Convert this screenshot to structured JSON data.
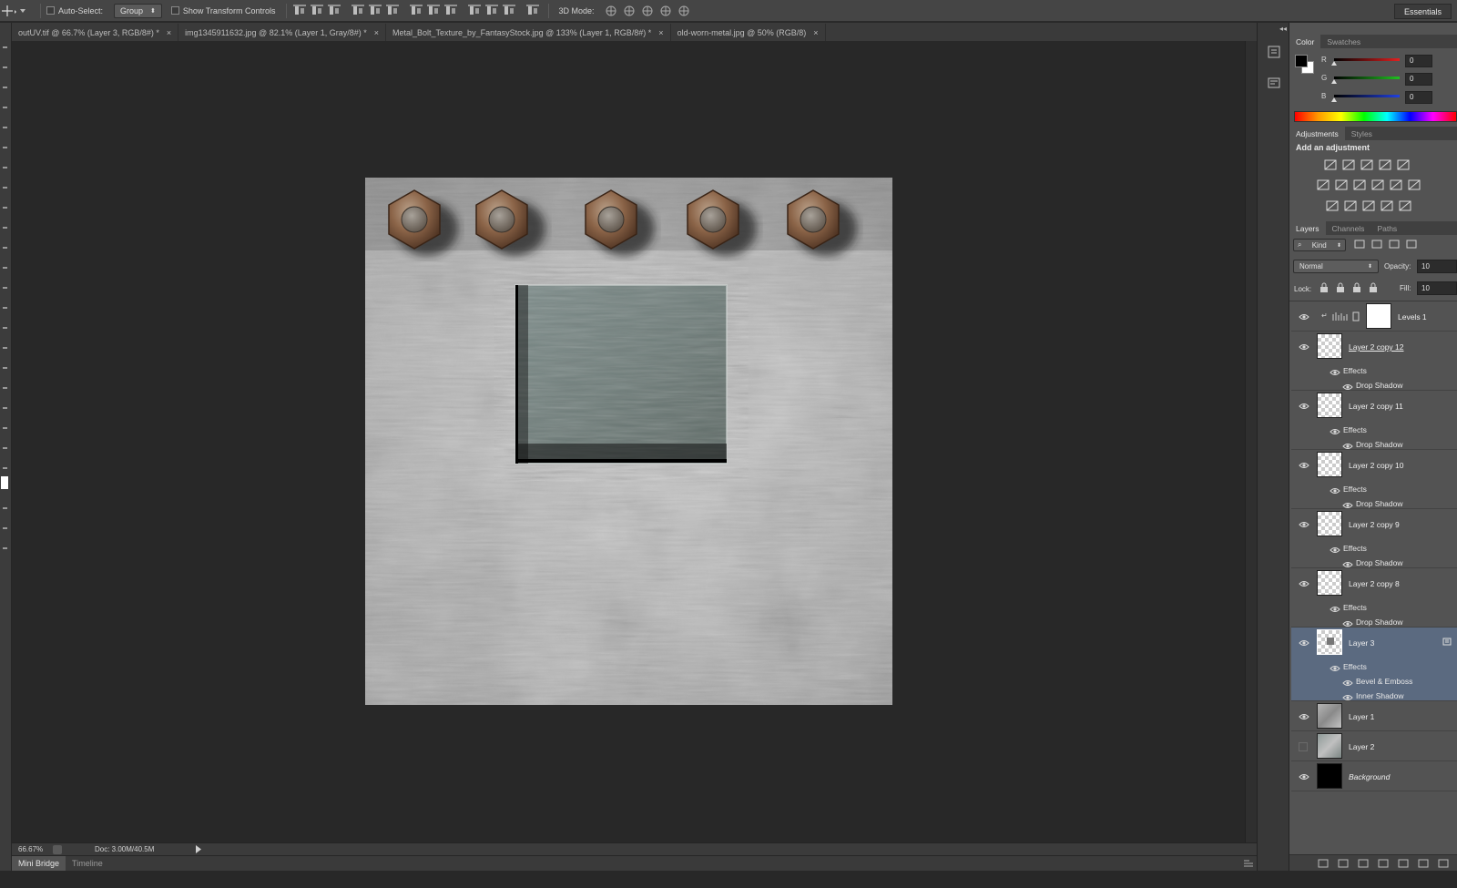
{
  "options_bar": {
    "auto_select_label": "Auto-Select:",
    "group_value": "Group",
    "show_transform_label": "Show Transform Controls",
    "mode_3d_label": "3D Mode:",
    "workspace": "Essentials"
  },
  "doc_tabs": [
    {
      "label": "outUV.tif @ 66.7% (Layer 3, RGB/8#) *",
      "active": true
    },
    {
      "label": "img1345911632.jpg @ 82.1% (Layer 1, Gray/8#) *",
      "active": false
    },
    {
      "label": "Metal_Bolt_Texture_by_FantasyStock.jpg @ 133% (Layer 1, RGB/8#) *",
      "active": false
    },
    {
      "label": "old-worn-metal.jpg @ 50% (RGB/8)",
      "active": false
    }
  ],
  "close_glyph": "×",
  "status": {
    "zoom": "66.67%",
    "doc": "Doc: 3.00M/40.5M"
  },
  "bottom_tabs": [
    "Mini Bridge",
    "Timeline"
  ],
  "color_panel": {
    "tabs": [
      "Color",
      "Swatches"
    ],
    "channels": [
      {
        "label": "R",
        "value": "0",
        "color": "#e02020"
      },
      {
        "label": "G",
        "value": "0",
        "color": "#20c020"
      },
      {
        "label": "B",
        "value": "0",
        "color": "#2040e0"
      }
    ],
    "foreground": "#000000",
    "background": "#ffffff"
  },
  "adjustments_panel": {
    "tabs": [
      "Adjustments",
      "Styles"
    ],
    "heading": "Add an adjustment"
  },
  "layers_panel": {
    "tabs": [
      "Layers",
      "Channels",
      "Paths"
    ],
    "filter_kind": "Kind",
    "blend_mode": "Normal",
    "opacity_label": "Opacity:",
    "opacity_value": "10",
    "lock_label": "Lock:",
    "fill_label": "Fill:",
    "fill_value": "10",
    "effects_label": "Effects",
    "layers": [
      {
        "name": "Levels 1",
        "type": "adjustment",
        "visible": true
      },
      {
        "name": "Layer 2 copy 12",
        "type": "empty",
        "visible": true,
        "effects": [
          "Drop Shadow"
        ]
      },
      {
        "name": "Layer 2 copy 11",
        "type": "empty",
        "visible": true,
        "effects": [
          "Drop Shadow"
        ]
      },
      {
        "name": "Layer 2 copy 10",
        "type": "empty",
        "visible": true,
        "effects": [
          "Drop Shadow"
        ]
      },
      {
        "name": "Layer 2 copy 9",
        "type": "empty",
        "visible": true,
        "effects": [
          "Drop Shadow"
        ]
      },
      {
        "name": "Layer 2 copy 8",
        "type": "empty",
        "visible": true,
        "effects": [
          "Drop Shadow"
        ]
      },
      {
        "name": "Layer 3",
        "type": "selected",
        "visible": true,
        "effects": [
          "Bevel & Emboss",
          "Inner Shadow"
        ]
      },
      {
        "name": "Layer 1",
        "type": "texture",
        "visible": true
      },
      {
        "name": "Layer 2",
        "type": "texture2",
        "visible": false
      },
      {
        "name": "Background",
        "type": "background",
        "visible": true
      }
    ]
  },
  "colors": {
    "panel_bg": "#535353",
    "selected_layer": "#5b6a80",
    "app_bg": "#282828"
  }
}
